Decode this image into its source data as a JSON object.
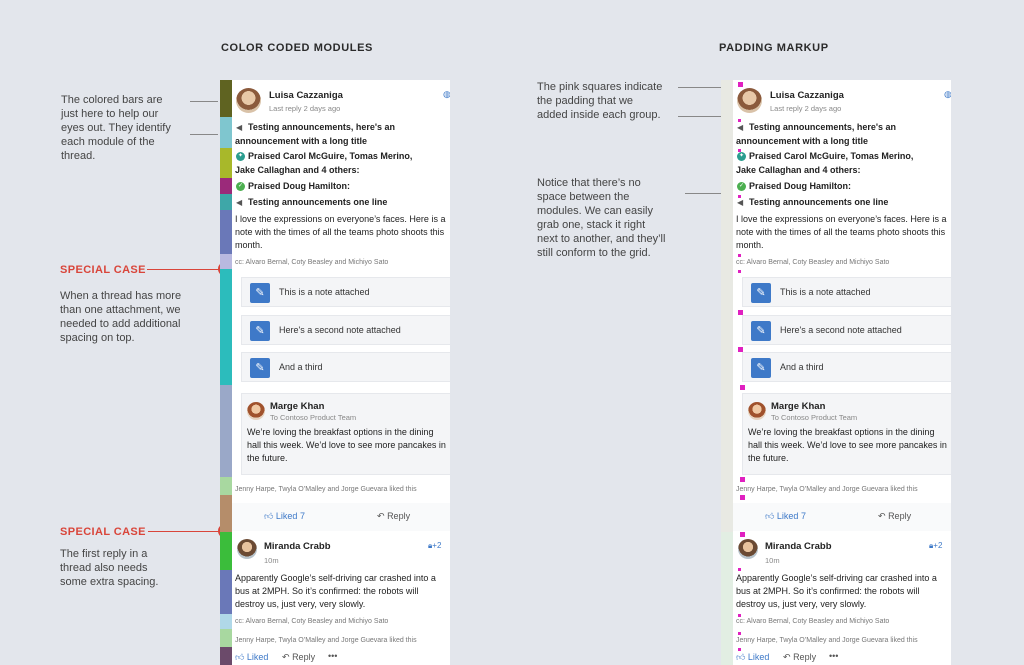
{
  "left": {
    "heading": "COLOR CODED MODULES",
    "note1": [
      "The colored bars are",
      "just here to help our",
      "eyes out. They identify",
      "each module of the",
      "thread."
    ],
    "special1": "SPECIAL CASE",
    "special1_text": [
      "When a thread has more",
      "than one attachment, we",
      "needed to add additional",
      "spacing on top."
    ],
    "special2": "SPECIAL CASE",
    "special2_text": [
      "The first reply in a",
      "thread also needs",
      "some extra spacing."
    ]
  },
  "right": {
    "heading": "PADDING MARKUP",
    "note1": [
      "The pink squares indicate",
      "the padding that we",
      "added inside each group."
    ],
    "note2": [
      "Notice that there’s no",
      "space between the",
      "modules. We can easily",
      "grab one, stack it right",
      "next to another, and they’ll",
      "still conform to the grid."
    ]
  },
  "thread": {
    "author": "Luisa Cazzaniga",
    "last_reply": "Last reply 2 days ago",
    "globe_icon": "globe-icon",
    "announce1_a": "Testing announcements, here's an",
    "announce1_b": "announcement with a long title",
    "praise1_a": "Praised Carol McGuire, Tomas Merino,",
    "praise1_b": "Jake Callaghan and 4 others:",
    "praise2": "Praised Doug Hamilton:",
    "announce2": "Testing announcements one line",
    "message": "I love the expressions on everyone’s faces. Here is a note with the times of all the teams photo shoots this month.",
    "cc": "cc: Alvaro Bernal, Coty Beasley and Michiyo Sato",
    "attachments": [
      "This is a note attached",
      "Here's a second note attached",
      "And a third"
    ],
    "reply_author": "Marge Khan",
    "reply_to": "To Contoso Product Team",
    "reply_text": "We’re loving the breakfast options in the dining hall this week. We’d love to see more pancakes in the future.",
    "liked_by": "Jenny Harpe, Twyla O’Malley and Jorge Guevara liked this",
    "liked_label": "Liked",
    "liked_count": "7",
    "reply_label": "Reply",
    "reply2_author": "Miranda Crabb",
    "reply2_time": "10m",
    "reply2_badge": "+2",
    "reply2_text": "Apparently Google’s self-driving car crashed into a bus at 2MPH. So it’s confirmed: the robots will destroy us, just very, very slowly.",
    "reply2_cc": "cc: Alvaro Bernal, Coty Beasley and Michiyo Sato",
    "reply2_liked_by": "Jenny Harpe, Twyla O’Malley and Jorge Guevara liked this",
    "reply2_liked": "Liked",
    "reply2_reply": "Reply",
    "more": "•••"
  },
  "colors": {
    "bar_header": "#5f6321",
    "bar_announce": "#7fc6cf",
    "bar_praise": "#a8b82a",
    "bar_praise2": "#9b2a7a",
    "bar_announce2": "#3ea7a8",
    "bar_message": "#6a78b8",
    "bar_cc": "#b9b9e0",
    "bar_attach": "#2cbcbc",
    "bar_reply": "#9aa8c8",
    "bar_liked": "#a8d8a0",
    "bar_actions": "#b58d6a",
    "bar_reply2": "#3bbd3b",
    "bar_reply2_body": "#6a78b8",
    "bar_reply2_cc": "#b0d8e8",
    "accent": "#3e79c8",
    "pink": "#e020c0",
    "special_red": "#d9453a"
  }
}
